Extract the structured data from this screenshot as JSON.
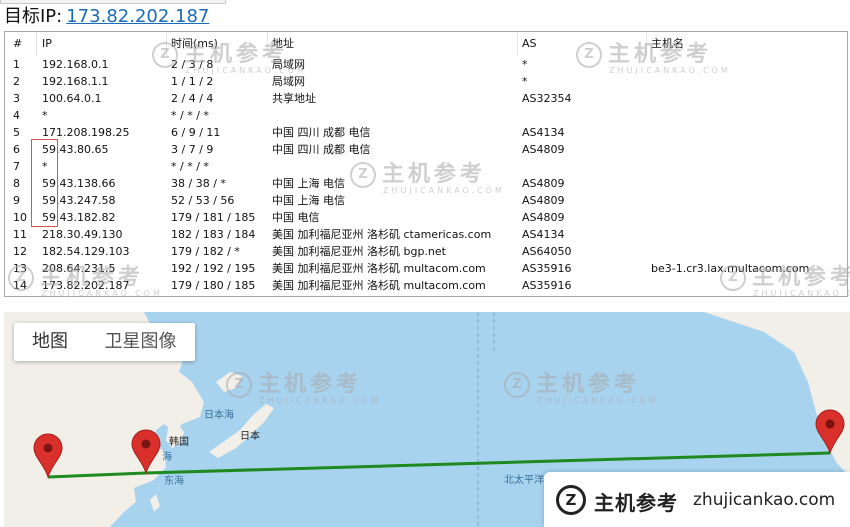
{
  "target": {
    "label": "目标IP:",
    "ip": "173.82.202.187"
  },
  "table": {
    "headers": [
      "#",
      "IP",
      "时间(ms)",
      "地址",
      "AS",
      "主机名"
    ],
    "rows": [
      [
        "1",
        "192.168.0.1",
        "2 / 3 / 8",
        "局域网",
        "*",
        ""
      ],
      [
        "2",
        "192.168.1.1",
        "1 / 1 / 2",
        "局域网",
        "*",
        ""
      ],
      [
        "3",
        "100.64.0.1",
        "2 / 4 / 4",
        "共享地址",
        "AS32354",
        ""
      ],
      [
        "4",
        "*",
        "* / * / *",
        "",
        "",
        ""
      ],
      [
        "5",
        "171.208.198.25",
        "6 / 9 / 11",
        "中国 四川 成都 电信",
        "AS4134",
        ""
      ],
      [
        "6",
        "59.43.80.65",
        "3 / 7 / 9",
        "中国 四川 成都 电信",
        "AS4809",
        ""
      ],
      [
        "7",
        "*",
        "* / * / *",
        "",
        "",
        ""
      ],
      [
        "8",
        "59.43.138.66",
        "38 / 38 / *",
        "中国 上海 电信",
        "AS4809",
        ""
      ],
      [
        "9",
        "59.43.247.58",
        "52 / 53 / 56",
        "中国 上海 电信",
        "AS4809",
        ""
      ],
      [
        "10",
        "59.43.182.82",
        "179 / 181 / 185",
        "中国 电信",
        "AS4809",
        ""
      ],
      [
        "11",
        "218.30.49.130",
        "182 / 183 / 184",
        "美国 加利福尼亚州 洛杉矶 ctamericas.com",
        "AS4134",
        ""
      ],
      [
        "12",
        "182.54.129.103",
        "179 / 182 / *",
        "美国 加利福尼亚州 洛杉矶 bgp.net",
        "AS64050",
        ""
      ],
      [
        "13",
        "208.64.231.5",
        "192 / 192 / 195",
        "美国 加利福尼亚州 洛杉矶 multacom.com",
        "AS35916",
        "be3-1.cr3.lax.multacom.com"
      ],
      [
        "14",
        "173.82.202.187",
        "179 / 180 / 185",
        "美国 加利福尼亚州 洛杉矶 multacom.com",
        "AS35916",
        ""
      ]
    ]
  },
  "map": {
    "tabs": [
      "地图",
      "卫星图像"
    ],
    "labels": {
      "sea_of_japan": "日本海",
      "korea": "韩国",
      "japan": "日本",
      "yellow_sea": "海",
      "east_sea": "东海",
      "north_pacific": "北太平洋"
    },
    "route_color": "#1f8a1f",
    "marker_color": "#d9302c"
  },
  "watermark": {
    "logo": "Z",
    "big": "主机参考",
    "small": "ZHUJICANKAO.COM"
  },
  "brand": {
    "logo": "Z",
    "name": "主机参考",
    "url": "zhujicankao.com"
  }
}
